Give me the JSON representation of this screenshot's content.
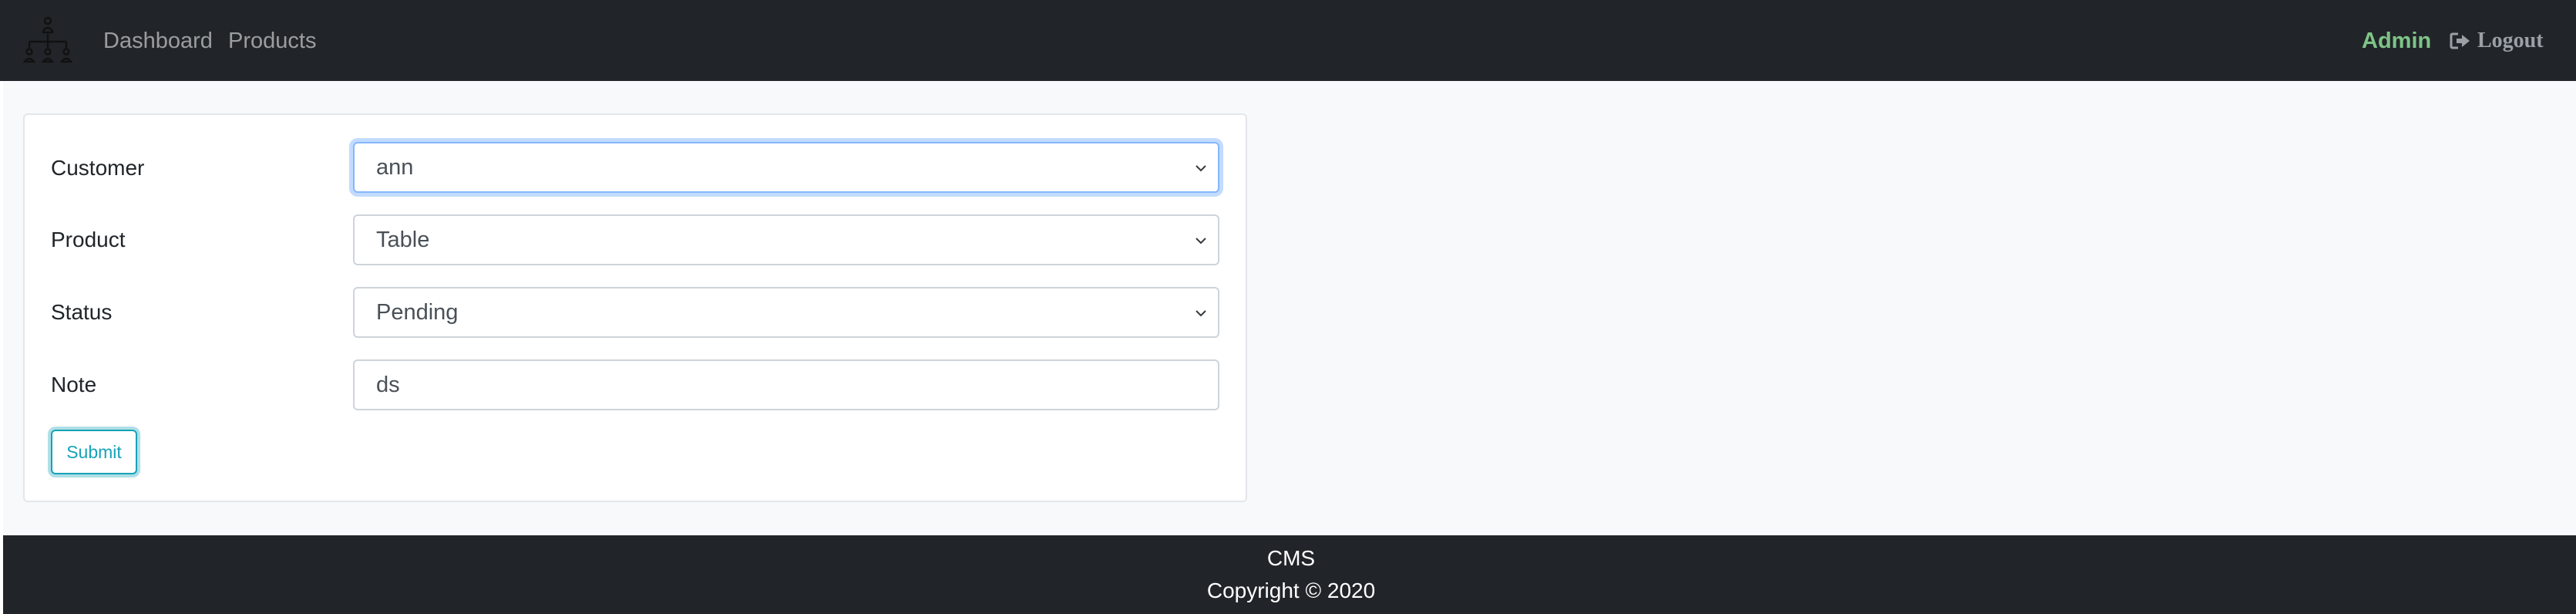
{
  "navbar": {
    "logo_icon": "org-chart-icon",
    "links": [
      {
        "label": "Dashboard"
      },
      {
        "label": "Products"
      }
    ],
    "user_label": "Admin",
    "logout_label": "Logout",
    "logout_icon": "sign-out-icon",
    "colors": {
      "background": "#212529",
      "user": "#7ec487"
    }
  },
  "form": {
    "fields": [
      {
        "label": "Customer",
        "type": "select",
        "value": "ann",
        "focused": true
      },
      {
        "label": "Product",
        "type": "select",
        "value": "Table"
      },
      {
        "label": "Status",
        "type": "select",
        "value": "Pending"
      },
      {
        "label": "Note",
        "type": "text",
        "value": "ds"
      }
    ],
    "submit_label": "Submit",
    "submit_color": "#17a2b8"
  },
  "footer": {
    "title": "CMS",
    "copyright": "Copyright © 2020"
  }
}
